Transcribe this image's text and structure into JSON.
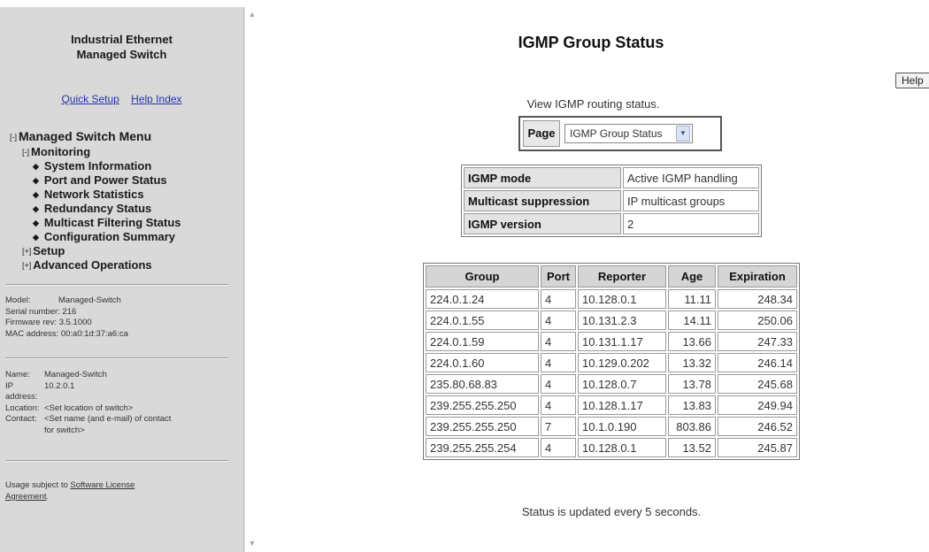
{
  "sidebar": {
    "product_title_line1": "Industrial Ethernet",
    "product_title_line2": "Managed Switch",
    "links": {
      "quick_setup": "Quick Setup",
      "help_index": "Help Index"
    },
    "menu": {
      "root_toggle": "[-]",
      "root_label": "Managed Switch Menu",
      "monitoring_toggle": "[-]",
      "monitoring_label": "Monitoring",
      "monitoring_items": [
        "System Information",
        "Port and Power Status",
        "Network Statistics",
        "Redundancy Status",
        "Multicast Filtering Status",
        "Configuration Summary"
      ],
      "setup_toggle": "[+]",
      "setup_label": "Setup",
      "advanced_toggle": "[+]",
      "advanced_label": "Advanced Operations"
    },
    "device": {
      "model_label": "Model:",
      "model_value": "Managed-Switch",
      "serial_label": "Serial number:",
      "serial_value": "216",
      "firmware_label": "Firmware rev:",
      "firmware_value": "3.5.1000",
      "mac_label": "MAC address:",
      "mac_value": "00:a0:1d:37:a6:ca"
    },
    "identity": {
      "name_label": "Name:",
      "name_value": "Managed-Switch",
      "ip_label_1": "IP",
      "ip_label_2": "address:",
      "ip_value": "10.2.0.1",
      "location_label": "Location:",
      "location_value": "<Set location of switch>",
      "contact_label": "Contact:",
      "contact_value_1": "<Set name (and e-mail) of contact",
      "contact_value_2": "for switch>"
    },
    "license": {
      "prefix": "Usage subject to ",
      "link_1": "Software License",
      "link_2": "Agreement",
      "suffix": "."
    }
  },
  "main": {
    "title": "IGMP Group Status",
    "help_button": "Help",
    "description": "View IGMP routing status.",
    "page_selector": {
      "label": "Page",
      "selected": "IGMP Group Status",
      "arrow": "▼"
    },
    "settings": [
      {
        "key": "IGMP mode",
        "value": "Active IGMP handling"
      },
      {
        "key": "Multicast suppression",
        "value": "IP multicast groups"
      },
      {
        "key": "IGMP version",
        "value": "2"
      }
    ],
    "groups_table": {
      "headers": [
        "Group",
        "Port",
        "Reporter",
        "Age",
        "Expiration"
      ],
      "rows": [
        [
          "224.0.1.24",
          "4",
          "10.128.0.1",
          "11.11",
          "248.34"
        ],
        [
          "224.0.1.55",
          "4",
          "10.131.2.3",
          "14.11",
          "250.06"
        ],
        [
          "224.0.1.59",
          "4",
          "10.131.1.17",
          "13.66",
          "247.33"
        ],
        [
          "224.0.1.60",
          "4",
          "10.129.0.202",
          "13.32",
          "246.14"
        ],
        [
          "235.80.68.83",
          "4",
          "10.128.0.7",
          "13.78",
          "245.68"
        ],
        [
          "239.255.255.250",
          "4",
          "10.128.1.17",
          "13.83",
          "249.94"
        ],
        [
          "239.255.255.250",
          "7",
          "10.1.0.190",
          "803.86",
          "246.52"
        ],
        [
          "239.255.255.254",
          "4",
          "10.128.0.1",
          "13.52",
          "245.87"
        ]
      ]
    },
    "footnote": "Status is updated every 5 seconds."
  }
}
